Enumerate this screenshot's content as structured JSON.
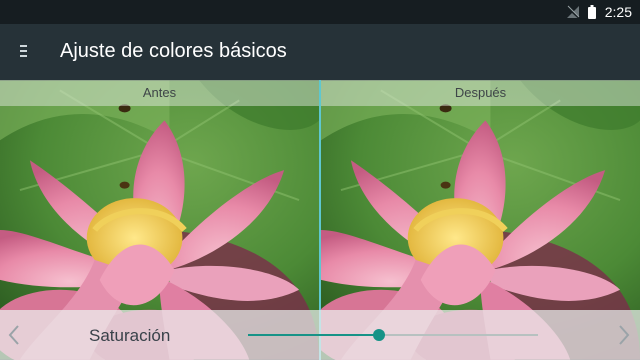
{
  "status_bar": {
    "time": "2:25",
    "icons": [
      "no-signal-icon",
      "battery-icon"
    ]
  },
  "app_bar": {
    "title": "Ajuste de colores básicos",
    "menu_icon": "menu-icon"
  },
  "comparison": {
    "before_label": "Antes",
    "after_label": "Después",
    "image_subject": "pink lotus flower with bee",
    "divider_color": "#5ec7cf"
  },
  "control": {
    "label": "Saturación",
    "level": 0.45,
    "prev_icon": "chevron-left-icon",
    "next_icon": "chevron-right-icon",
    "accent_color": "#169387"
  }
}
